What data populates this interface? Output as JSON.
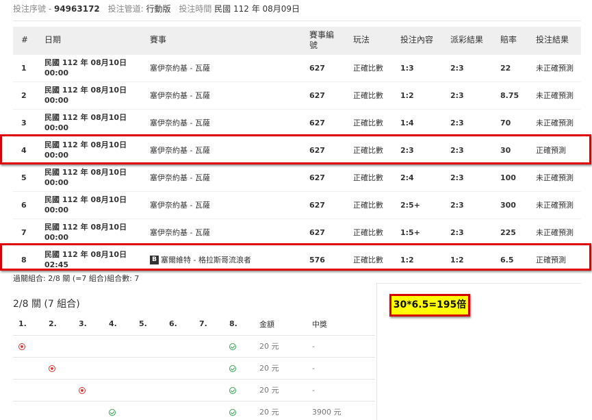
{
  "header": {
    "serial_label": "投注序號 - ",
    "serial_value": "94963172",
    "channel_label": "投注管道:",
    "channel_value": "行動版",
    "time_label": "投注時間",
    "time_value": "民國 112 年 08月09日"
  },
  "bets_table": {
    "columns": [
      "#",
      "日期",
      "賽事",
      "賽事編號",
      "玩法",
      "投注內容",
      "派彩結果",
      "賠率",
      "投注結果"
    ],
    "rows": [
      {
        "no": "1",
        "date": "民國 112 年 08月10日",
        "time": "00:00",
        "match": "塞伊奈約基 - 瓦薩",
        "tag": "",
        "code": "627",
        "play": "正確比數",
        "pick": "1:3",
        "result": "2:3",
        "odds": "22",
        "outcome": "未正確預測"
      },
      {
        "no": "2",
        "date": "民國 112 年 08月10日",
        "time": "00:00",
        "match": "塞伊奈約基 - 瓦薩",
        "tag": "",
        "code": "627",
        "play": "正確比數",
        "pick": "1:2",
        "result": "2:3",
        "odds": "8.75",
        "outcome": "未正確預測"
      },
      {
        "no": "3",
        "date": "民國 112 年 08月10日",
        "time": "00:00",
        "match": "塞伊奈約基 - 瓦薩",
        "tag": "",
        "code": "627",
        "play": "正確比數",
        "pick": "1:4",
        "result": "2:3",
        "odds": "70",
        "outcome": "未正確預測"
      },
      {
        "no": "4",
        "date": "民國 112 年 08月10日",
        "time": "00:00",
        "match": "塞伊奈約基 - 瓦薩",
        "tag": "",
        "code": "627",
        "play": "正確比數",
        "pick": "2:3",
        "result": "2:3",
        "odds": "30",
        "outcome": "正確預測"
      },
      {
        "no": "5",
        "date": "民國 112 年 08月10日",
        "time": "00:00",
        "match": "塞伊奈約基 - 瓦薩",
        "tag": "",
        "code": "627",
        "play": "正確比數",
        "pick": "2:4",
        "result": "2:3",
        "odds": "100",
        "outcome": "未正確預測"
      },
      {
        "no": "6",
        "date": "民國 112 年 08月10日",
        "time": "00:00",
        "match": "塞伊奈約基 - 瓦薩",
        "tag": "",
        "code": "627",
        "play": "正確比數",
        "pick": "2:5+",
        "result": "2:3",
        "odds": "300",
        "outcome": "未正確預測"
      },
      {
        "no": "7",
        "date": "民國 112 年 08月10日",
        "time": "00:00",
        "match": "塞伊奈約基 - 瓦薩",
        "tag": "",
        "code": "627",
        "play": "正確比數",
        "pick": "1:5+",
        "result": "2:3",
        "odds": "225",
        "outcome": "未正確預測"
      },
      {
        "no": "8",
        "date": "民國 112 年 08月10日",
        "time": "02:45",
        "match": "塞爾維特 - 格拉斯哥流浪者",
        "tag": "B",
        "code": "576",
        "play": "正確比數",
        "pick": "1:2",
        "result": "1:2",
        "odds": "6.5",
        "outcome": "正確預測"
      }
    ]
  },
  "combo_summary": "過關組合: 2/8 關 (=7 組合)組合數: 7",
  "combos": {
    "title": "2/8 關 (7 組合)",
    "columns": [
      "1.",
      "2.",
      "3.",
      "4.",
      "5.",
      "6.",
      "7.",
      "8.",
      "金額",
      "中獎"
    ],
    "rows": [
      {
        "cells": [
          "x",
          "",
          "",
          "",
          "",
          "",
          "",
          "ok"
        ],
        "amount": "20 元",
        "win": "-"
      },
      {
        "cells": [
          "",
          "x",
          "",
          "",
          "",
          "",
          "",
          "ok"
        ],
        "amount": "20 元",
        "win": "-"
      },
      {
        "cells": [
          "",
          "",
          "x",
          "",
          "",
          "",
          "",
          "ok"
        ],
        "amount": "20 元",
        "win": "-"
      },
      {
        "cells": [
          "",
          "",
          "",
          "ok",
          "",
          "",
          "",
          "ok"
        ],
        "amount": "20 元",
        "win": "3900 元"
      }
    ]
  },
  "callout": {
    "text": "30*6.5=195倍",
    "bg_color": "#ffff00",
    "border_color": "#d40000"
  },
  "colors": {
    "highlight_border": "#e00000",
    "miss_icon": "#d42f2f",
    "hit_icon": "#2e9f4a",
    "header_bg": "#efefef"
  }
}
